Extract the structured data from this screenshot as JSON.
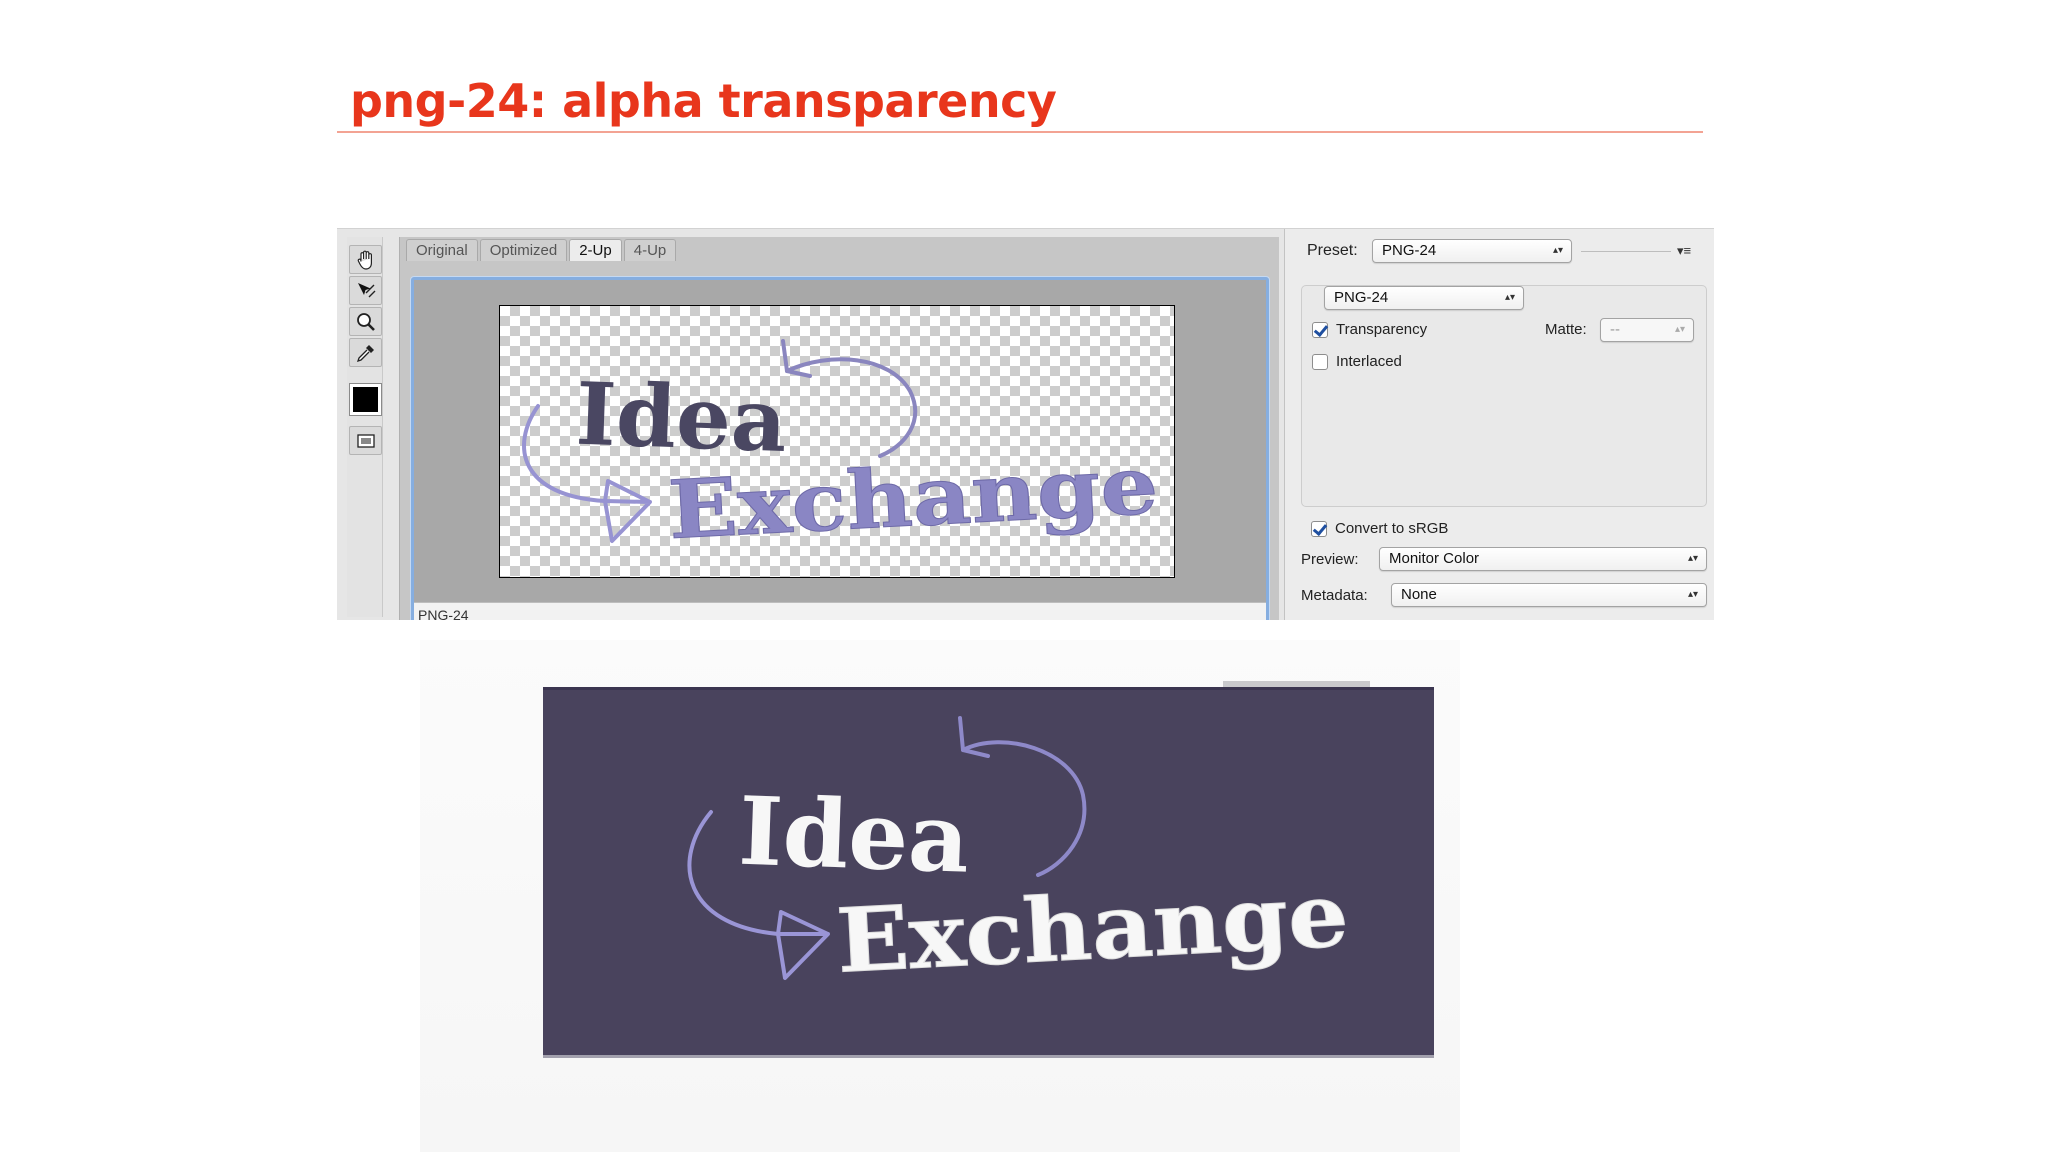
{
  "slide": {
    "title": "png-24: alpha transparency"
  },
  "save_for_web": {
    "tabs": [
      {
        "label": "Original",
        "active": false
      },
      {
        "label": "Optimized",
        "active": false
      },
      {
        "label": "2-Up",
        "active": true
      },
      {
        "label": "4-Up",
        "active": false
      }
    ],
    "tools": [
      "hand-icon",
      "slice-select-icon",
      "zoom-icon",
      "eyedropper-icon",
      "eyedropper-color-swatch",
      "toggle-slices-icon"
    ],
    "eyedropper_color": "#000000",
    "pane_caption": "PNG-24",
    "preset": {
      "label": "Preset:",
      "value": "PNG-24"
    },
    "format": {
      "value": "PNG-24"
    },
    "transparency": {
      "label": "Transparency",
      "checked": true
    },
    "interlaced": {
      "label": "Interlaced",
      "checked": false
    },
    "matte": {
      "label": "Matte:",
      "value": "--"
    },
    "convert_srgb": {
      "label": "Convert to sRGB",
      "checked": true
    },
    "preview": {
      "label": "Preview:",
      "value": "Monitor Color"
    },
    "metadata": {
      "label": "Metadata:",
      "value": "None"
    }
  },
  "logo": {
    "line1": "Idea",
    "line2": "Exchange",
    "colors": {
      "idea_on_checker": "#4a4762",
      "exchange_on_checker": "#8a86c4",
      "on_dark": "#f7f7f7",
      "arrow": "#9590d0",
      "dark_background": "#49435d"
    }
  }
}
